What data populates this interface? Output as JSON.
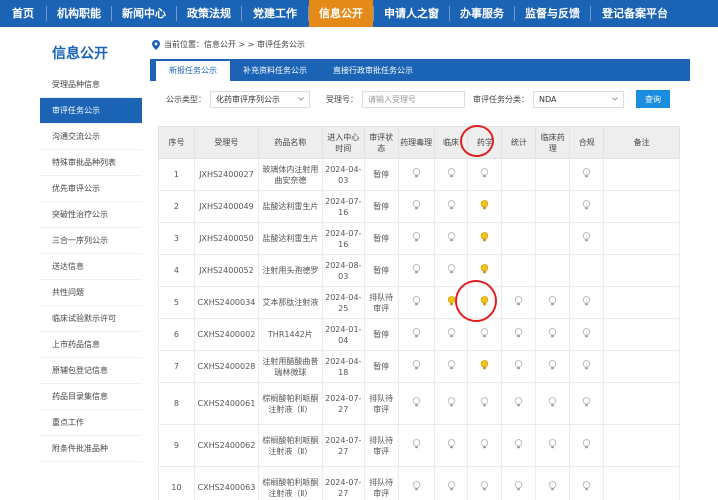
{
  "topnav": {
    "items": [
      "首页",
      "机构职能",
      "新闻中心",
      "政策法规",
      "党建工作",
      "信息公开",
      "申请人之窗",
      "办事服务",
      "监督与反馈",
      "登记备案平台"
    ],
    "active_index": 5,
    "active_color": "#e58a19",
    "bar_color": "#1a63b5"
  },
  "sidebar": {
    "title": "信息公开",
    "items": [
      "受理品种信息",
      "审评任务公示",
      "沟通交流公示",
      "特殊审批品种列表",
      "优先审评公示",
      "突破性治疗公示",
      "三合一序列公示",
      "送达信息",
      "共性问题",
      "临床试验默示许可",
      "上市药品信息",
      "原辅包登记信息",
      "药品目录集信息",
      "重点工作",
      "附条件批准品种"
    ],
    "active_index": 1
  },
  "breadcrumb": {
    "text": "当前位置：信息公开 > > 审评任务公示",
    "icon": "location-pin-icon"
  },
  "tabs": [
    "新报任务公示",
    "补充资料任务公示",
    "直接行政审批任务公示"
  ],
  "active_tab": 0,
  "filters": {
    "type_label": "公示类型：",
    "type_value": "化药审评序列公示",
    "accept_label": "受理号：",
    "accept_placeholder": "请输入受理号",
    "category_label": "审评任务分类：",
    "category_value": "NDA",
    "search_label": "查询"
  },
  "table": {
    "headers": [
      "序号",
      "受理号",
      "药品名称",
      "进入中心时间",
      "审评状态",
      "药理毒理",
      "临床",
      "药学",
      "统计",
      "临床药理",
      "合规",
      "备注"
    ],
    "rows": [
      {
        "no": "1",
        "id": "JXHS2400027",
        "name": "玻璃体内注射用曲安奈德",
        "date": "2024-04-03",
        "status": "暂停",
        "bulbs": [
          "grey",
          "grey",
          "grey",
          "",
          "",
          "grey"
        ]
      },
      {
        "no": "2",
        "id": "JXHS2400049",
        "name": "盐酸达利雷生片",
        "date": "2024-07-16",
        "status": "暂停",
        "bulbs": [
          "grey",
          "grey",
          "yellow",
          "",
          "",
          "grey"
        ]
      },
      {
        "no": "3",
        "id": "JXHS2400050",
        "name": "盐酸达利雷生片",
        "date": "2024-07-16",
        "status": "暂停",
        "bulbs": [
          "grey",
          "grey",
          "yellow",
          "",
          "",
          "grey"
        ]
      },
      {
        "no": "4",
        "id": "JXHS2400052",
        "name": "注射用头孢德罗",
        "date": "2024-08-03",
        "status": "暂停",
        "bulbs": [
          "grey",
          "grey",
          "yellow",
          "",
          "",
          ""
        ]
      },
      {
        "no": "5",
        "id": "CXHS2400034",
        "name": "艾本那肽注射液",
        "date": "2024-04-25",
        "status": "排队待审评",
        "bulbs": [
          "grey",
          "yellow",
          "yellow",
          "grey",
          "grey",
          "grey"
        ]
      },
      {
        "no": "6",
        "id": "CXHS2400002",
        "name": "THR1442片",
        "date": "2024-01-04",
        "status": "暂停",
        "bulbs": [
          "grey",
          "grey",
          "grey",
          "grey",
          "grey",
          "grey"
        ]
      },
      {
        "no": "7",
        "id": "CXHS2400028",
        "name": "注射用醋酸曲普瑞林微球",
        "date": "2024-04-18",
        "status": "暂停",
        "bulbs": [
          "grey",
          "grey",
          "yellow",
          "grey",
          "grey",
          "grey"
        ]
      },
      {
        "no": "8",
        "id": "CXHS2400061",
        "name": "棕榈酸帕利哌酮注射液（Ⅱ）",
        "date": "2024-07-27",
        "status": "排队待审评",
        "bulbs": [
          "grey",
          "grey",
          "grey",
          "grey",
          "grey",
          "grey"
        ]
      },
      {
        "no": "9",
        "id": "CXHS2400062",
        "name": "棕榈酸帕利哌酮注射液（Ⅱ）",
        "date": "2024-07-27",
        "status": "排队待审评",
        "bulbs": [
          "grey",
          "grey",
          "grey",
          "grey",
          "grey",
          "grey"
        ]
      },
      {
        "no": "10",
        "id": "CXHS2400063",
        "name": "棕榈酸帕利哌酮注射液（Ⅱ）",
        "date": "2024-07-27",
        "status": "排队待审评",
        "bulbs": [
          "grey",
          "grey",
          "grey",
          "grey",
          "grey",
          "grey"
        ]
      }
    ]
  },
  "colors": {
    "bulb_yellow": "#f2c21b",
    "bulb_grey": "#c4c4c4",
    "annotation_red": "#e02020"
  }
}
